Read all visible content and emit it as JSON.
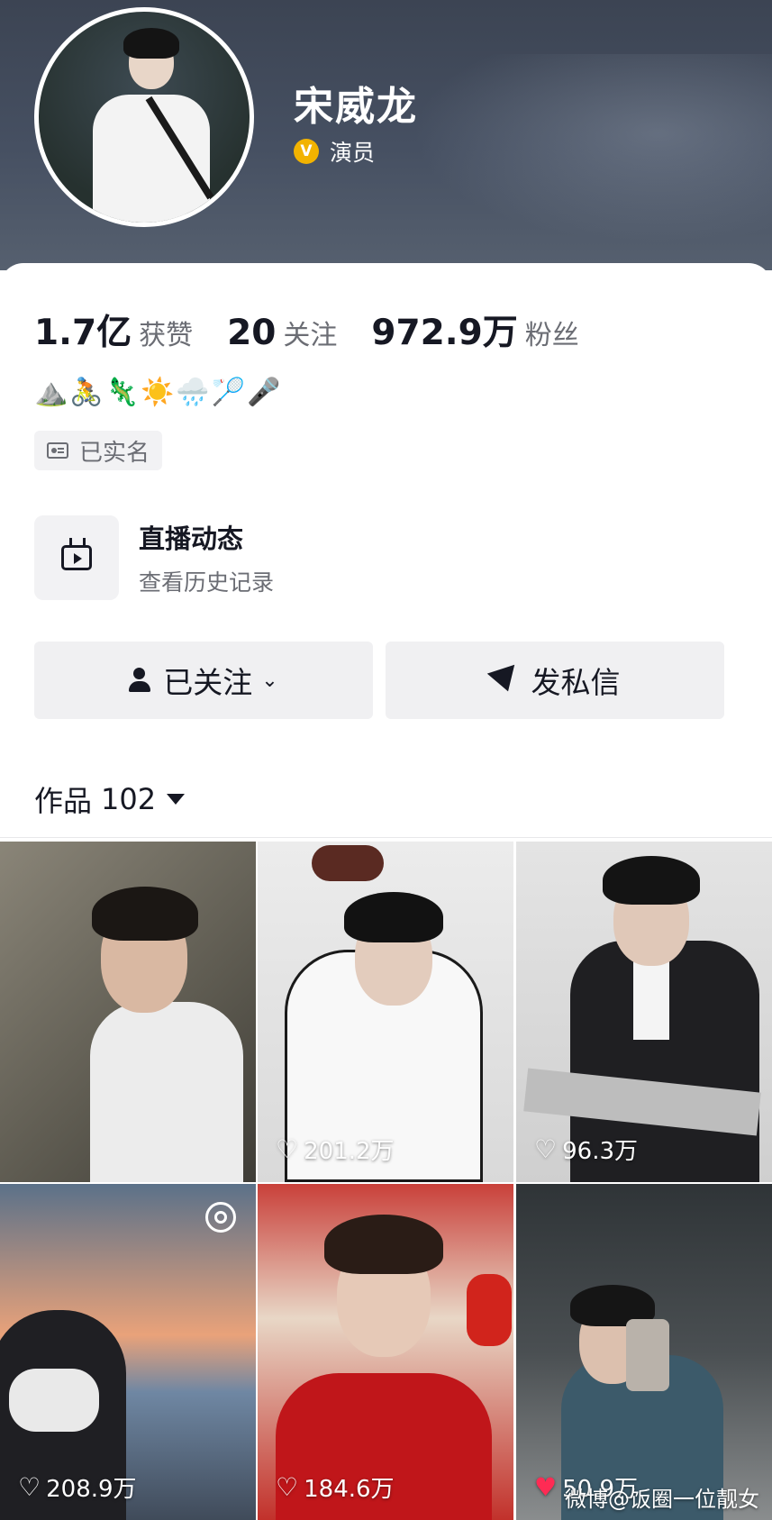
{
  "profile": {
    "name": "宋威龙",
    "verified_badge": "V",
    "role": "演员"
  },
  "stats": [
    {
      "value": "1.7亿",
      "label": "获赞"
    },
    {
      "value": "20",
      "label": "关注"
    },
    {
      "value": "972.9万",
      "label": "粉丝"
    }
  ],
  "bio_emojis": "⛰️🚴🦎☀️🌧️🏸🎤",
  "real_name_label": "已实名",
  "live": {
    "title": "直播动态",
    "subtitle": "查看历史记录"
  },
  "buttons": {
    "follow_label": "已关注",
    "message_label": "发私信"
  },
  "works": {
    "label": "作品",
    "count": "102"
  },
  "videos": [
    {
      "likes": ""
    },
    {
      "likes": "201.2万"
    },
    {
      "likes": "96.3万"
    },
    {
      "likes": "208.9万"
    },
    {
      "likes": "184.6万"
    },
    {
      "likes": "50.9万"
    }
  ],
  "watermark": "微博@饭圈一位靓女",
  "colors": {
    "header_bg": "#465062",
    "verify_gold": "#f2b300",
    "like_red": "#ff2b54",
    "text_primary": "#161823",
    "text_secondary": "#6b6d74"
  }
}
